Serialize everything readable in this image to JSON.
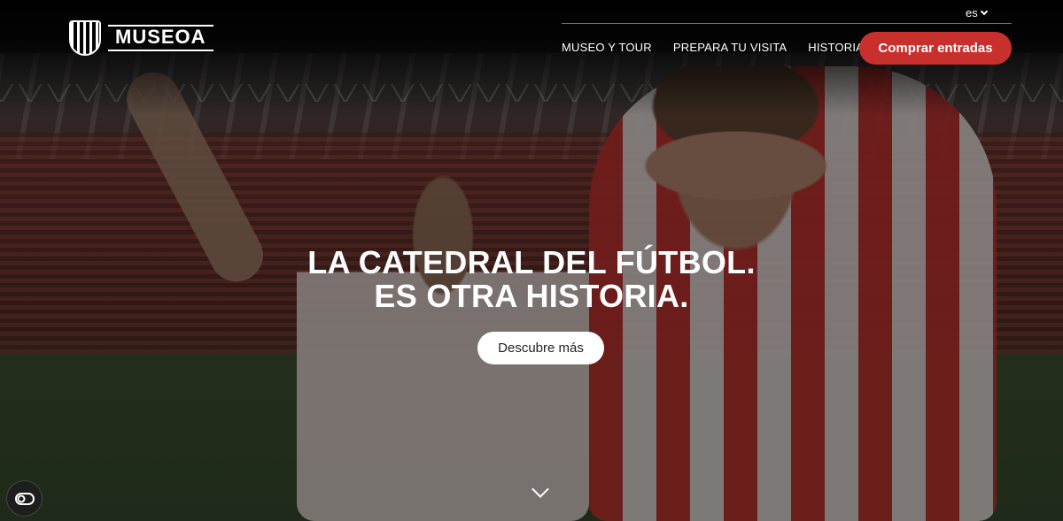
{
  "brand": {
    "logo_text": "MUSEOA",
    "logo_icon": "athletic-club-crest-icon"
  },
  "header": {
    "language": "es",
    "nav": [
      {
        "label": "MUSEO Y TOUR"
      },
      {
        "label": "PREPARA TU VISITA"
      },
      {
        "label": "HISTORIA"
      }
    ],
    "buy_button": "Comprar entradas"
  },
  "hero": {
    "headline_line1": "LA CATEDRAL DEL FÚTBOL.",
    "headline_line2": "ES OTRA HISTORIA.",
    "cta": "Descubre más",
    "scroll_icon": "chevron-down-icon"
  },
  "accessibility": {
    "icon": "accessibility-toggle-icon"
  },
  "colors": {
    "accent": "#c8302e",
    "header_bg": "#000000"
  }
}
